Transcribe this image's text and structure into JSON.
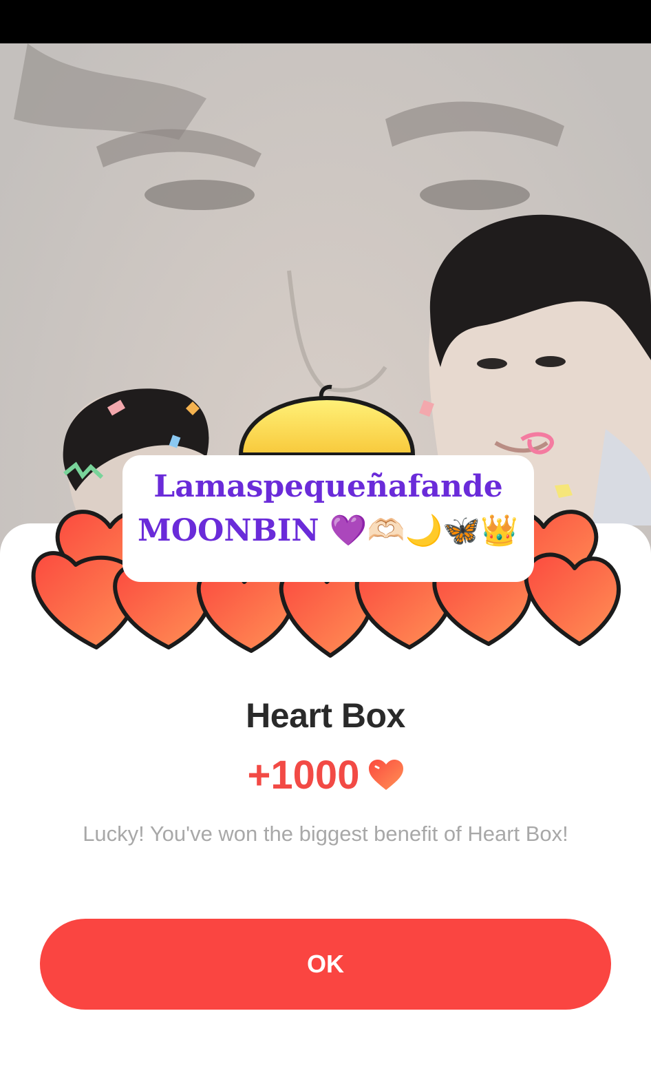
{
  "caption": {
    "line1": "Lamaspequeñafande",
    "line2": "MOONBIN 💜🫶🏻🌙🦋👑"
  },
  "dialog": {
    "title": "Heart Box",
    "reward_amount": "+1000",
    "reward_icon": "heart-icon",
    "message": "Lucky! You've won the biggest benefit of Heart Box!",
    "ok_label": "OK"
  },
  "colors": {
    "accent": "#fa4541",
    "reward_text": "#f24a45",
    "caption_text": "#6a2bd9",
    "title_text": "#2a2a2a",
    "message_text": "#a8a8a8"
  }
}
